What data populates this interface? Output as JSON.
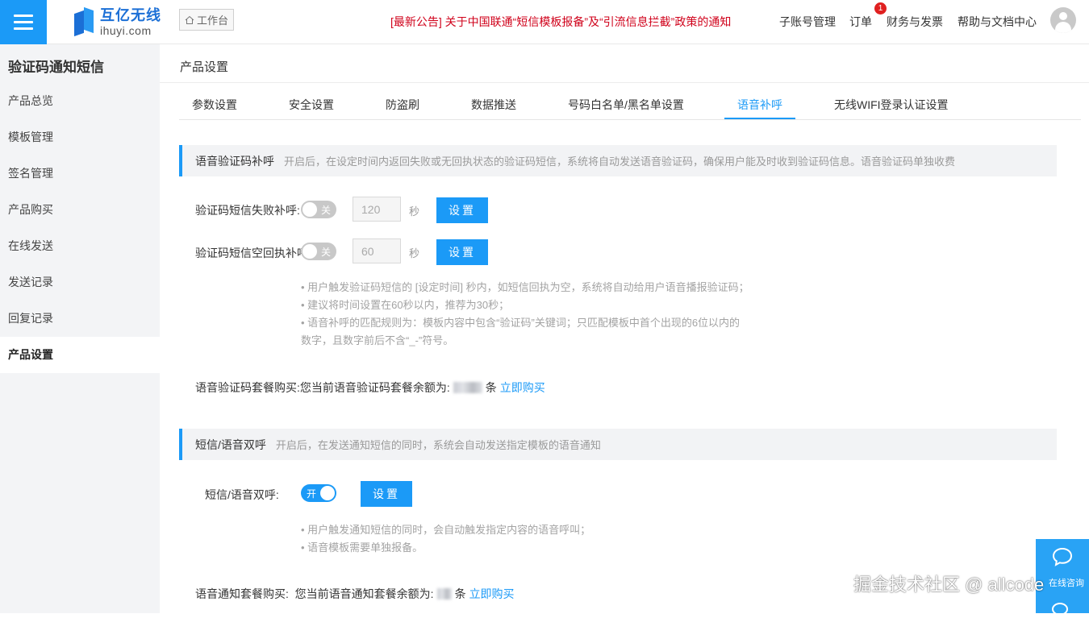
{
  "header": {
    "logo_cn": "互亿无线",
    "logo_en": "ihuyi.com",
    "workbench": "工作台",
    "notice": "[最新公告] 关于中国联通“短信模板报备”及“引流信息拦截”政策的通知",
    "nav": {
      "sub_account": "子账号管理",
      "orders": "订单",
      "orders_badge": "1",
      "finance": "财务与发票",
      "help": "帮助与文档中心"
    }
  },
  "sidebar": {
    "title": "验证码通知短信",
    "items": [
      {
        "label": "产品总览"
      },
      {
        "label": "模板管理"
      },
      {
        "label": "签名管理"
      },
      {
        "label": "产品购买"
      },
      {
        "label": "在线发送"
      },
      {
        "label": "发送记录"
      },
      {
        "label": "回复记录"
      },
      {
        "label": "产品设置",
        "active": true
      }
    ]
  },
  "main": {
    "page_title": "产品设置",
    "tabs": [
      {
        "label": "参数设置"
      },
      {
        "label": "安全设置"
      },
      {
        "label": "防盗刷"
      },
      {
        "label": "数据推送"
      },
      {
        "label": "号码白名单/黑名单设置"
      },
      {
        "label": "语音补呼",
        "active": true
      },
      {
        "label": "无线WIFI登录认证设置"
      }
    ],
    "voice_section": {
      "title": "语音验证码补呼",
      "desc": "开启后，在设定时间内返回失败或无回执状态的验证码短信，系统将自动发送语音验证码，确保用户能及时收到验证码信息。语音验证码单独收费",
      "rows": [
        {
          "label": "验证码短信失败补呼:",
          "toggle": "关",
          "value": "120",
          "unit": "秒",
          "button": "设置"
        },
        {
          "label": "验证码短信空回执补呼",
          "toggle": "关",
          "value": "60",
          "unit": "秒",
          "button": "设置"
        }
      ],
      "tips": [
        "• 用户触发验证码短信的 [设定时间] 秒内，如短信回执为空，系统将自动给用户语音播报验证码；",
        "• 建议将时间设置在60秒以内，推荐为30秒；",
        "• 语音补呼的匹配规则为：模板内容中包含“验证码”关键词；只匹配模板中首个出现的6位以内的",
        "数字，且数字前后不含“_-”符号。"
      ],
      "buy_label": "语音验证码套餐购买:您当前语音验证码套餐余额为:",
      "buy_unit": "条",
      "buy_link": "立即购买"
    },
    "dual_section": {
      "title": "短信/语音双呼",
      "desc": "开启后，在发送通知短信的同时，系统会自动发送指定模板的语音通知",
      "row": {
        "label": "短信/语音双呼:",
        "toggle": "开",
        "button": "设置"
      },
      "tips": [
        "• 用户触发通知短信的同时，会自动触发指定内容的语音呼叫；",
        "• 语音模板需要单独报备。"
      ],
      "buy_label": "语音通知套餐购买:  您当前语音通知套餐余额为:",
      "buy_unit": "条",
      "buy_link": "立即购买"
    }
  },
  "float_widget": {
    "label": "在线咨询"
  },
  "watermark": "掘金技术社区 @ allcode",
  "colors": {
    "accent": "#1b9af7",
    "notice": "#d0021b",
    "sidebar_bg": "#f3f4f6"
  }
}
